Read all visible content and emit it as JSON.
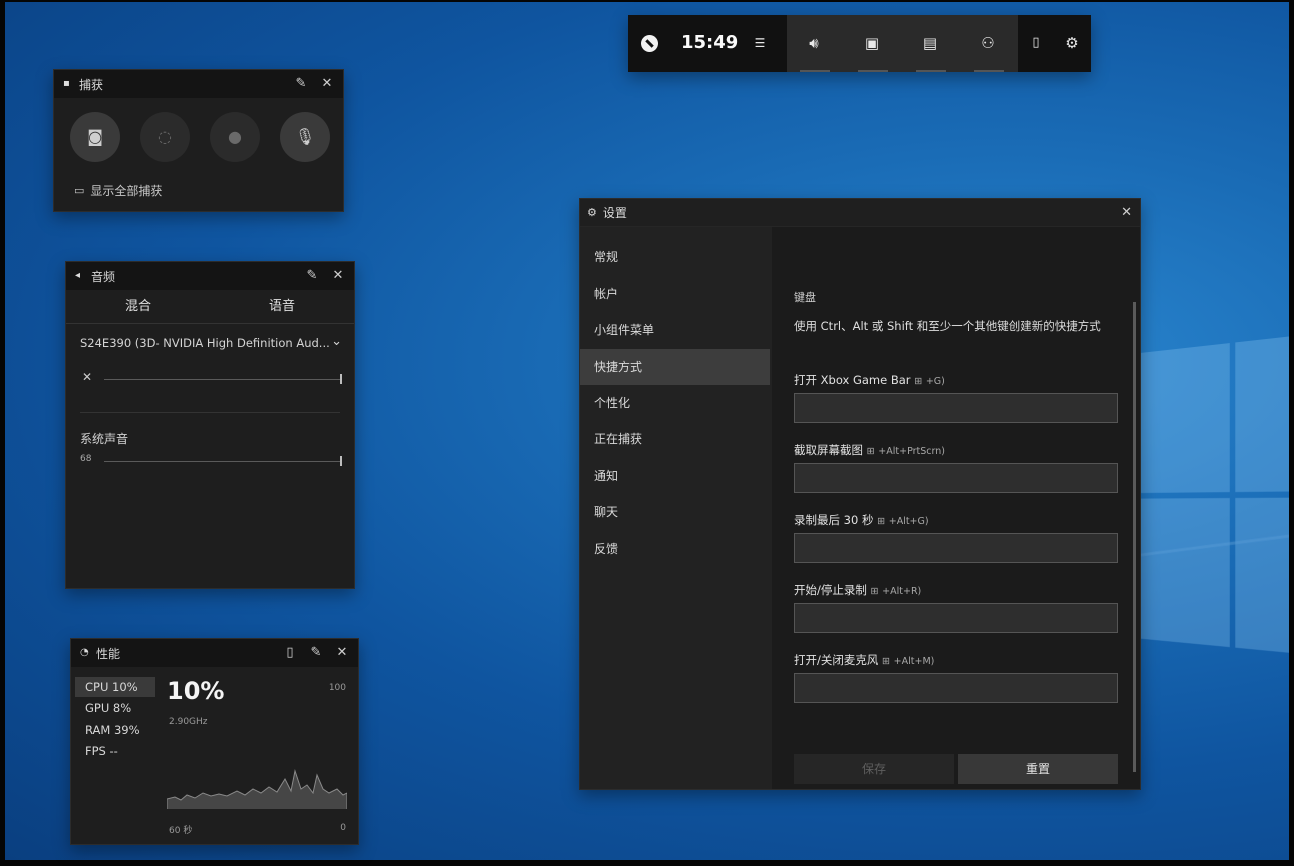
{
  "gamebar": {
    "time": "15:49",
    "icons": [
      "xbox-logo-icon",
      "menu-icon",
      "audio-icon",
      "capture-icon",
      "performance-icon",
      "xbox-social-icon",
      "mouse-icon",
      "settings-icon"
    ]
  },
  "capture": {
    "title": "捕获",
    "buttons": [
      "camera-icon",
      "record-last-icon",
      "record-icon",
      "mic-off-icon"
    ],
    "show_all": "显示全部捕获"
  },
  "audio": {
    "title": "音频",
    "tabs": [
      "混合",
      "语音"
    ],
    "device": "S24E390 (3D- NVIDIA High Definition Aud...",
    "system_sound": "系统声音",
    "system_value": "68"
  },
  "performance": {
    "title": "性能",
    "rows": [
      "CPU 10%",
      "GPU  8%",
      "RAM  39%",
      "FPS --"
    ],
    "big_value": "10%",
    "speed": "2.90GHz",
    "max": "100",
    "min": "0",
    "seconds": "60 秒"
  },
  "settings": {
    "title": "设置",
    "nav": [
      "常规",
      "帐户",
      "小组件菜单",
      "快捷方式",
      "个性化",
      "正在捕获",
      "通知",
      "聊天",
      "反馈"
    ],
    "section": "键盘",
    "description": "使用 Ctrl、Alt 或 Shift 和至少一个其他键创建新的快捷方式",
    "fields": [
      {
        "label": "打开 Xbox Game Bar",
        "key": "+G)"
      },
      {
        "label": "截取屏幕截图",
        "key": "+Alt+PrtScrn)"
      },
      {
        "label": "录制最后 30 秒",
        "key": "+Alt+G)"
      },
      {
        "label": "开始/停止录制",
        "key": "+Alt+R)"
      },
      {
        "label": "打开/关闭麦克风",
        "key": "+Alt+M)"
      }
    ],
    "save": "保存",
    "reset": "重置"
  }
}
